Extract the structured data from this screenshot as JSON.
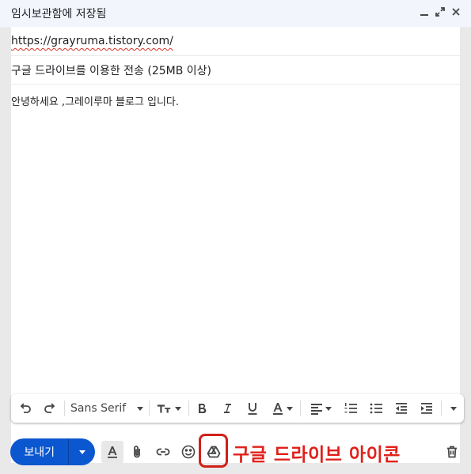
{
  "header": {
    "title": "임시보관함에 저장됨"
  },
  "fields": {
    "recipient": "https://grayruma.tistory.com/",
    "subject": "구글 드라이브를 이용한 전송 (25MB 이상)"
  },
  "message": {
    "body": "안녕하세요 ,그레이루마 블로그 입니다."
  },
  "toolbar": {
    "font_family": "Sans Serif"
  },
  "actions": {
    "send_label": "보내기"
  },
  "annotation": {
    "text": "구글 드라이브 아이콘"
  },
  "colors": {
    "send_button": "#0b57d0",
    "annotation": "#e0201a",
    "header_bg": "#f2f6fc"
  },
  "icons": {
    "window": [
      "minimize-icon",
      "pop-out-icon",
      "close-icon"
    ],
    "toolbar": [
      "undo-icon",
      "redo-icon",
      "text-size-icon",
      "bold-icon",
      "italic-icon",
      "underline-icon",
      "text-color-icon",
      "align-icon",
      "numbered-list-icon",
      "bulleted-list-icon",
      "indent-less-icon",
      "indent-more-icon",
      "more-formatting-icon"
    ],
    "actions": [
      "formatting-options-icon",
      "attach-icon",
      "link-icon",
      "emoji-icon",
      "google-drive-icon",
      "trash-icon"
    ]
  }
}
